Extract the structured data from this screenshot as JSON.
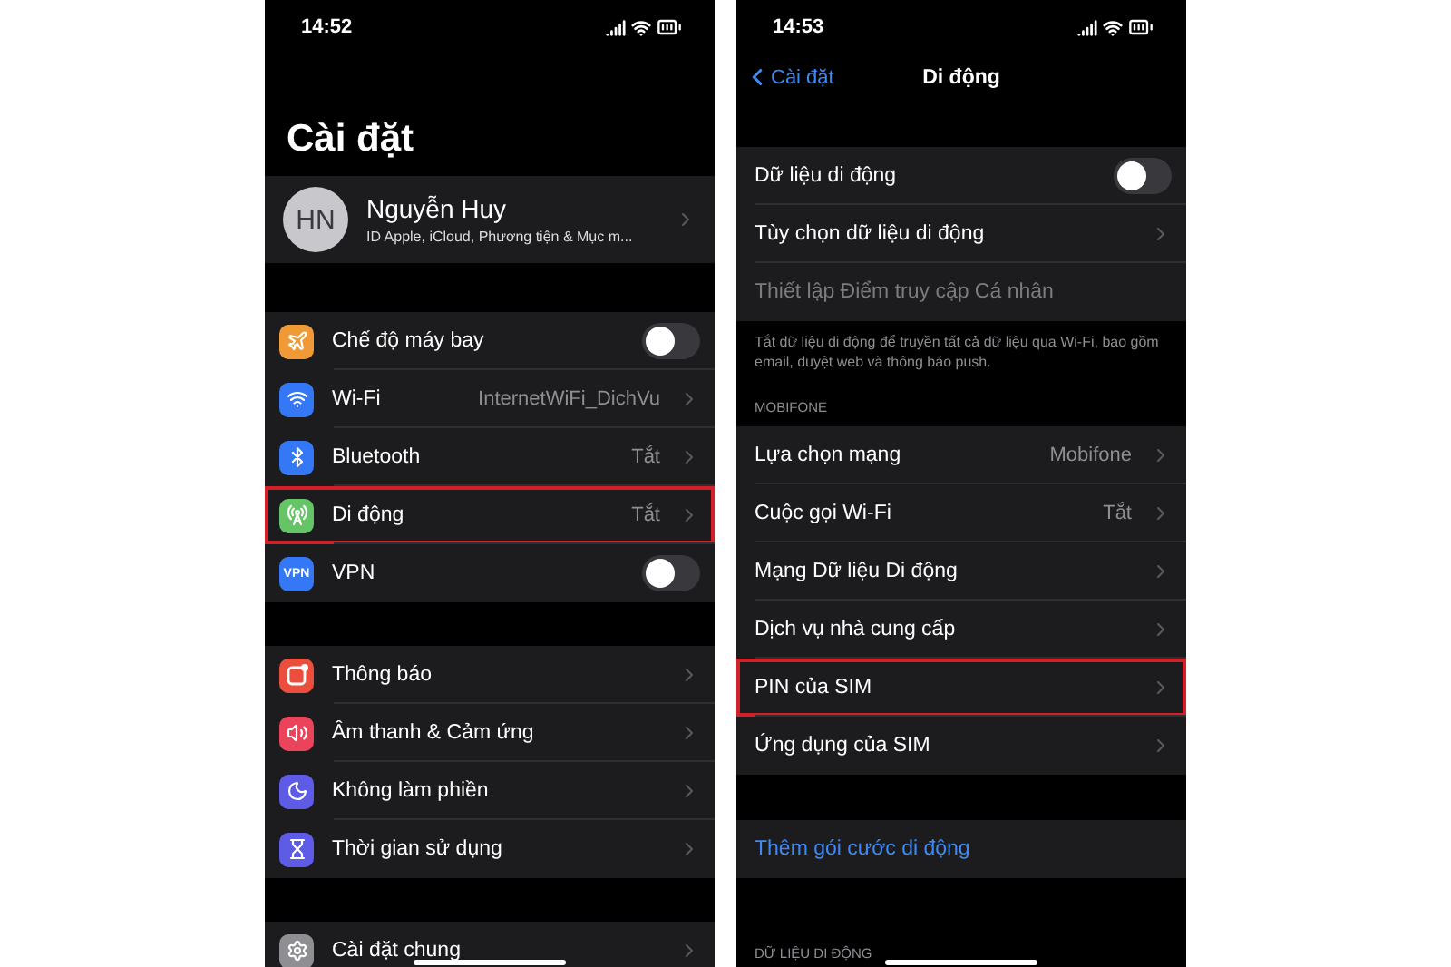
{
  "screens": [
    {
      "status_time": "14:52",
      "title": "Cài đặt",
      "profile": {
        "initials": "HN",
        "name": "Nguyễn Huy",
        "subtitle": "ID Apple, iCloud, Phương tiện & Mục m..."
      },
      "groups": [
        {
          "rows": [
            {
              "kind": "toggle",
              "label": "Chế độ máy bay",
              "color": "#f09a37",
              "on": false,
              "highlighted": false
            },
            {
              "kind": "link",
              "label": "Wi-Fi",
              "color": "#3478f6",
              "value": "InternetWiFi_DichVu",
              "highlighted": false
            },
            {
              "kind": "link",
              "label": "Bluetooth",
              "color": "#3478f6",
              "value": "Tắt",
              "highlighted": false
            },
            {
              "kind": "link",
              "label": "Di động",
              "color": "#65c466",
              "value": "Tắt",
              "highlighted": true
            },
            {
              "kind": "toggle",
              "label": "VPN",
              "color": "#3478f6",
              "icon_text": "VPN",
              "on": false,
              "highlighted": false
            }
          ]
        },
        {
          "rows": [
            {
              "kind": "link",
              "label": "Thông báo",
              "color": "#eb4e3d",
              "highlighted": false
            },
            {
              "kind": "link",
              "label": "Âm thanh & Cảm ứng",
              "color": "#eb445a",
              "highlighted": false
            },
            {
              "kind": "link",
              "label": "Không làm phiền",
              "color": "#5e5ce6",
              "highlighted": false
            },
            {
              "kind": "link",
              "label": "Thời gian sử dụng",
              "color": "#5e5ce6",
              "highlighted": false
            }
          ]
        },
        {
          "rows": [
            {
              "kind": "link",
              "label": "Cài đặt chung",
              "color": "#8e8e93",
              "highlighted": false
            }
          ]
        }
      ]
    },
    {
      "status_time": "14:53",
      "nav": {
        "back": "Cài đặt",
        "title": "Di động"
      },
      "groups": [
        {
          "rows": [
            {
              "kind": "toggle",
              "label": "Dữ liệu di động",
              "on": false,
              "disabled": false,
              "highlighted": false
            },
            {
              "kind": "link",
              "label": "Tùy chọn dữ liệu di động",
              "disabled": false,
              "highlighted": false
            },
            {
              "kind": "plain",
              "label": "Thiết lập Điểm truy cập Cá nhân",
              "disabled": true,
              "highlighted": false
            }
          ],
          "footer": "Tắt dữ liệu di động để truyền tất cả dữ liệu qua Wi-Fi, bao gồm email, duyệt web và thông báo push."
        },
        {
          "header": "MOBIFONE",
          "rows": [
            {
              "kind": "link",
              "label": "Lựa chọn mạng",
              "value": "Mobifone",
              "highlighted": false
            },
            {
              "kind": "link",
              "label": "Cuộc gọi Wi-Fi",
              "value": "Tắt",
              "highlighted": false
            },
            {
              "kind": "link",
              "label": "Mạng Dữ liệu Di động",
              "highlighted": false
            },
            {
              "kind": "link",
              "label": "Dịch vụ nhà cung cấp",
              "highlighted": false
            },
            {
              "kind": "link",
              "label": "PIN của SIM",
              "highlighted": true
            },
            {
              "kind": "link",
              "label": "Ứng dụng của SIM",
              "highlighted": false
            }
          ]
        },
        {
          "rows": [
            {
              "kind": "action",
              "label": "Thêm gói cước di động",
              "highlighted": false
            }
          ]
        },
        {
          "header": "DỮ LIỆU DI ĐỘNG"
        }
      ]
    }
  ]
}
